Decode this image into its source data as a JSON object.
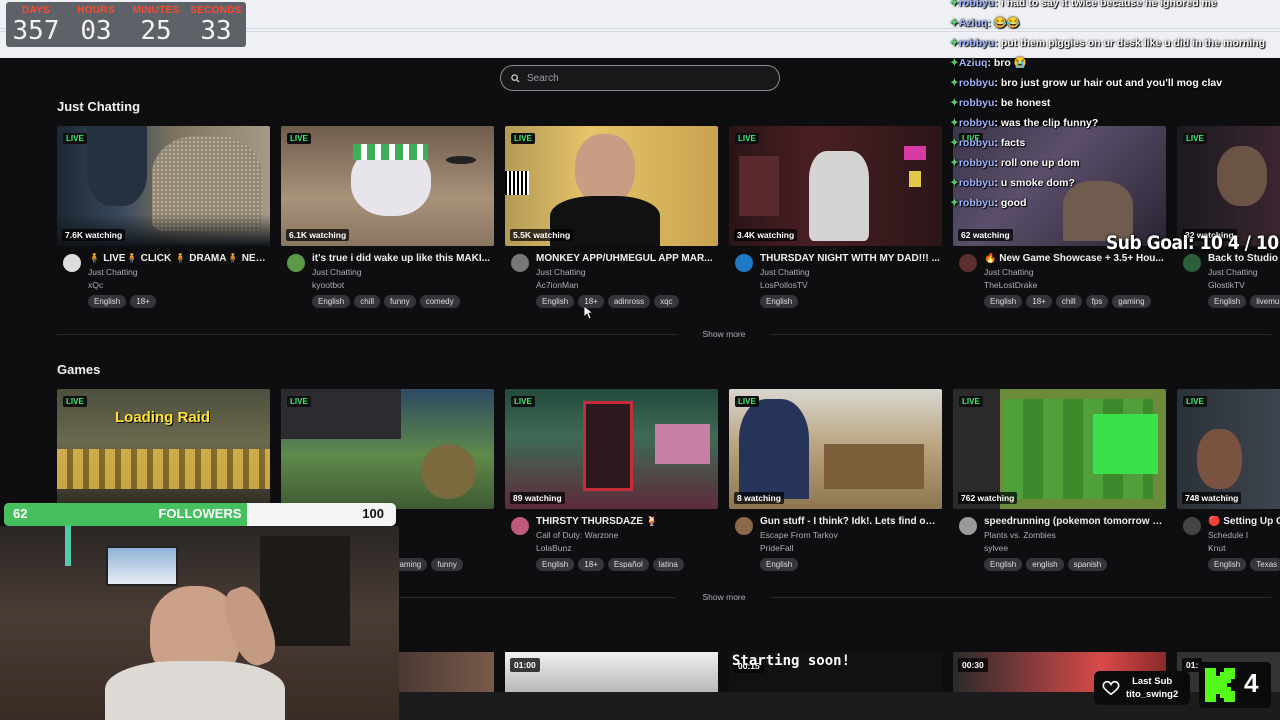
{
  "timer": {
    "days_label": "DAYS",
    "hours_label": "HOURS",
    "minutes_label": "MINUTES",
    "seconds_label": "SECONDS",
    "days": "357",
    "hours": "03",
    "minutes": "25",
    "seconds": "33"
  },
  "search": {
    "placeholder": "Search"
  },
  "sections": {
    "just_chatting": "Just Chatting",
    "games": "Games"
  },
  "show_more": "Show more",
  "live_label": "LIVE",
  "row1": [
    {
      "title": "🧍 LIVE🧍 CLICK 🧍 DRAMA🧍 NEWS...",
      "category": "Just Chatting",
      "streamer": "xQc",
      "viewers": "7.6K watching",
      "tags": [
        "English",
        "18+"
      ]
    },
    {
      "title": "it's true i did wake up like this MAKI...",
      "category": "Just Chatting",
      "streamer": "kyootbot",
      "viewers": "6.1K watching",
      "tags": [
        "English",
        "chill",
        "funny",
        "comedy"
      ]
    },
    {
      "title": "MONKEY APP/UHMEGUL APP MAR...",
      "category": "Just Chatting",
      "streamer": "Ac7ionMan",
      "viewers": "5.5K watching",
      "tags": [
        "English",
        "18+",
        "adinross",
        "xqc"
      ]
    },
    {
      "title": "THURSDAY NIGHT WITH MY DAD!!! ...",
      "category": "Just Chatting",
      "streamer": "LosPollosTV",
      "viewers": "3.4K watching",
      "tags": [
        "English"
      ]
    },
    {
      "title": "🔥 New Game Showcase + 3.5+ Hou...",
      "category": "Just Chatting",
      "streamer": "TheLostDrake",
      "viewers": "62 watching",
      "tags": [
        "English",
        "18+",
        "chill",
        "fps",
        "gaming"
      ]
    },
    {
      "title": "Back to Studio A",
      "category": "Just Chatting",
      "streamer": "GlostikTV",
      "viewers": "32 watching",
      "tags": [
        "English",
        "livemu"
      ]
    }
  ],
  "row2": [
    {
      "title": "",
      "category": "",
      "streamer": "",
      "viewers": "",
      "tags": []
    },
    {
      "title": "",
      "category": "",
      "streamer": "",
      "viewers": "",
      "tags": [
        "gaming",
        "funny"
      ]
    },
    {
      "title": "THIRSTY THURSDAZE 🍹",
      "category": "Call of Duty: Warzone",
      "streamer": "LolaBunz",
      "viewers": "89 watching",
      "tags": [
        "English",
        "18+",
        "Español",
        "latina"
      ]
    },
    {
      "title": "Gun stuff - I think? Idk!. Lets find out...",
      "category": "Escape From Tarkov",
      "streamer": "PrideFall",
      "viewers": "8 watching",
      "tags": [
        "English"
      ]
    },
    {
      "title": "speedrunning (pokemon tomorrow :c)",
      "category": "Plants vs. Zombies",
      "streamer": "sylvee",
      "viewers": "762 watching",
      "tags": [
        "English",
        "english",
        "spanish"
      ]
    },
    {
      "title": "🔴 Setting Up O",
      "category": "Schedule I",
      "streamer": "Knut",
      "viewers": "748 watching",
      "tags": [
        "English",
        "Texas"
      ]
    }
  ],
  "thumb_texts": {
    "loading_raid": "Loading Raid",
    "starting_soon": "Starting soon!"
  },
  "durations": [
    "01:00",
    "00:15",
    "00:30",
    "01:"
  ],
  "chat": [
    {
      "user": "robbyu",
      "msg": "i had to say it twice because he ignored me"
    },
    {
      "user": "Aziuq",
      "msg": "😂😂"
    },
    {
      "user": "robbyu",
      "msg": "put them piggies on ur desk like u did in the morning"
    },
    {
      "user": "Aziuq",
      "msg": "bro 😭"
    },
    {
      "user": "robbyu",
      "msg": "bro just grow ur hair out and you'll mog clav"
    },
    {
      "user": "robbyu",
      "msg": "be honest"
    },
    {
      "user": "robbyu",
      "msg": "was the clip funny?"
    },
    {
      "user": "robbyu",
      "msg": "facts"
    },
    {
      "user": "robbyu",
      "msg": "roll one up dom"
    },
    {
      "user": "robbyu",
      "msg": "u smoke dom?"
    },
    {
      "user": "robbyu",
      "msg": "good"
    }
  ],
  "sub_goal": "Sub Goal: 10  4 / 10",
  "followers": {
    "current": "62",
    "label": "FOLLOWERS",
    "goal": "100",
    "progress": 0.62
  },
  "last_sub": {
    "label": "Last Sub",
    "user": "tito_swing2"
  },
  "kick_count": "4"
}
